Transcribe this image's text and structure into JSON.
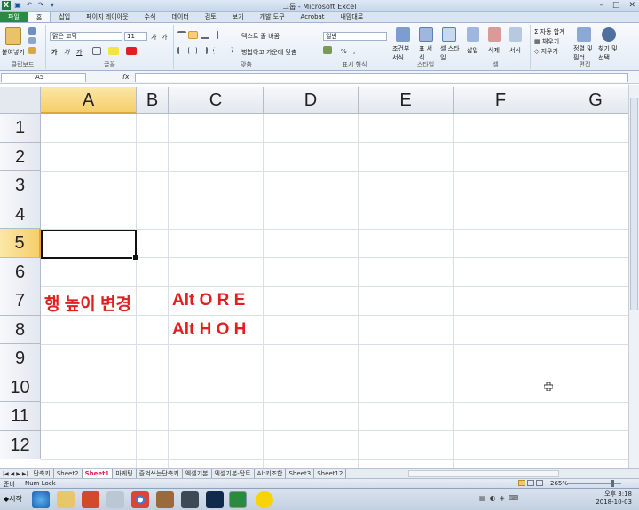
{
  "window": {
    "title": "그룹 - Microsoft Excel",
    "qat_icons": [
      "excel-logo-icon",
      "save-icon",
      "undo-icon",
      "redo-icon"
    ]
  },
  "ribbon_tabs": [
    "파일",
    "홈",
    "삽입",
    "페이지 레이아웃",
    "수식",
    "데이터",
    "검토",
    "보기",
    "개발 도구",
    "Acrobat",
    "내맘대로"
  ],
  "ribbon": {
    "clipboard": {
      "paste": "붙여넣기",
      "label": "클립보드"
    },
    "font": {
      "family": "맑은 고딕",
      "size": "11",
      "bold": "가",
      "italic": "가",
      "underline": "가",
      "grow": "가",
      "shrink": "가",
      "label": "글꼴"
    },
    "alignment": {
      "wrap": "텍스트 줄 바꿈",
      "merge": "병합하고 가운데 맞춤",
      "label": "맞춤"
    },
    "number": {
      "format": "일반",
      "percent": "%",
      "comma": ",",
      "label": "표시 형식"
    },
    "styles": {
      "cond": "조건부 서식",
      "table": "표 서식",
      "cell": "셀 스타일",
      "label": "스타일"
    },
    "cells": {
      "insert": "삽입",
      "delete": "삭제",
      "format": "서식",
      "label": "셀"
    },
    "editing": {
      "autosum": "자동 합계",
      "fill": "채우기",
      "clear": "지우기",
      "sort": "정렬 및 필터",
      "find": "찾기 및 선택",
      "label": "편집"
    }
  },
  "formula_bar": {
    "name_box": "A5",
    "fx": "fx",
    "value": ""
  },
  "columns": [
    "A",
    "B",
    "C",
    "D",
    "E",
    "F",
    "G"
  ],
  "rows": [
    "1",
    "2",
    "3",
    "4",
    "5",
    "6",
    "7",
    "8",
    "9",
    "10",
    "11",
    "12"
  ],
  "selected": {
    "column": "A",
    "row": "5"
  },
  "cells": {
    "A7": "행 높이 변경",
    "C7": "Alt O R E",
    "C8": "Alt H O H"
  },
  "text_color": "#e02020",
  "sheet_tabs": [
    "단축키",
    "Sheet2",
    "Sheet1",
    "마케팅",
    "즐겨쓰는단축키",
    "엑셀기본",
    "엑셀기본-탑트",
    "Alt키조합",
    "Sheet3",
    "Sheet12"
  ],
  "active_sheet": "Sheet1",
  "status": {
    "mode": "준비",
    "numlock": "Num Lock",
    "zoom": "265%"
  },
  "taskbar": {
    "start": "시작",
    "time": "오후 3:18",
    "date": "2018-10-03"
  }
}
